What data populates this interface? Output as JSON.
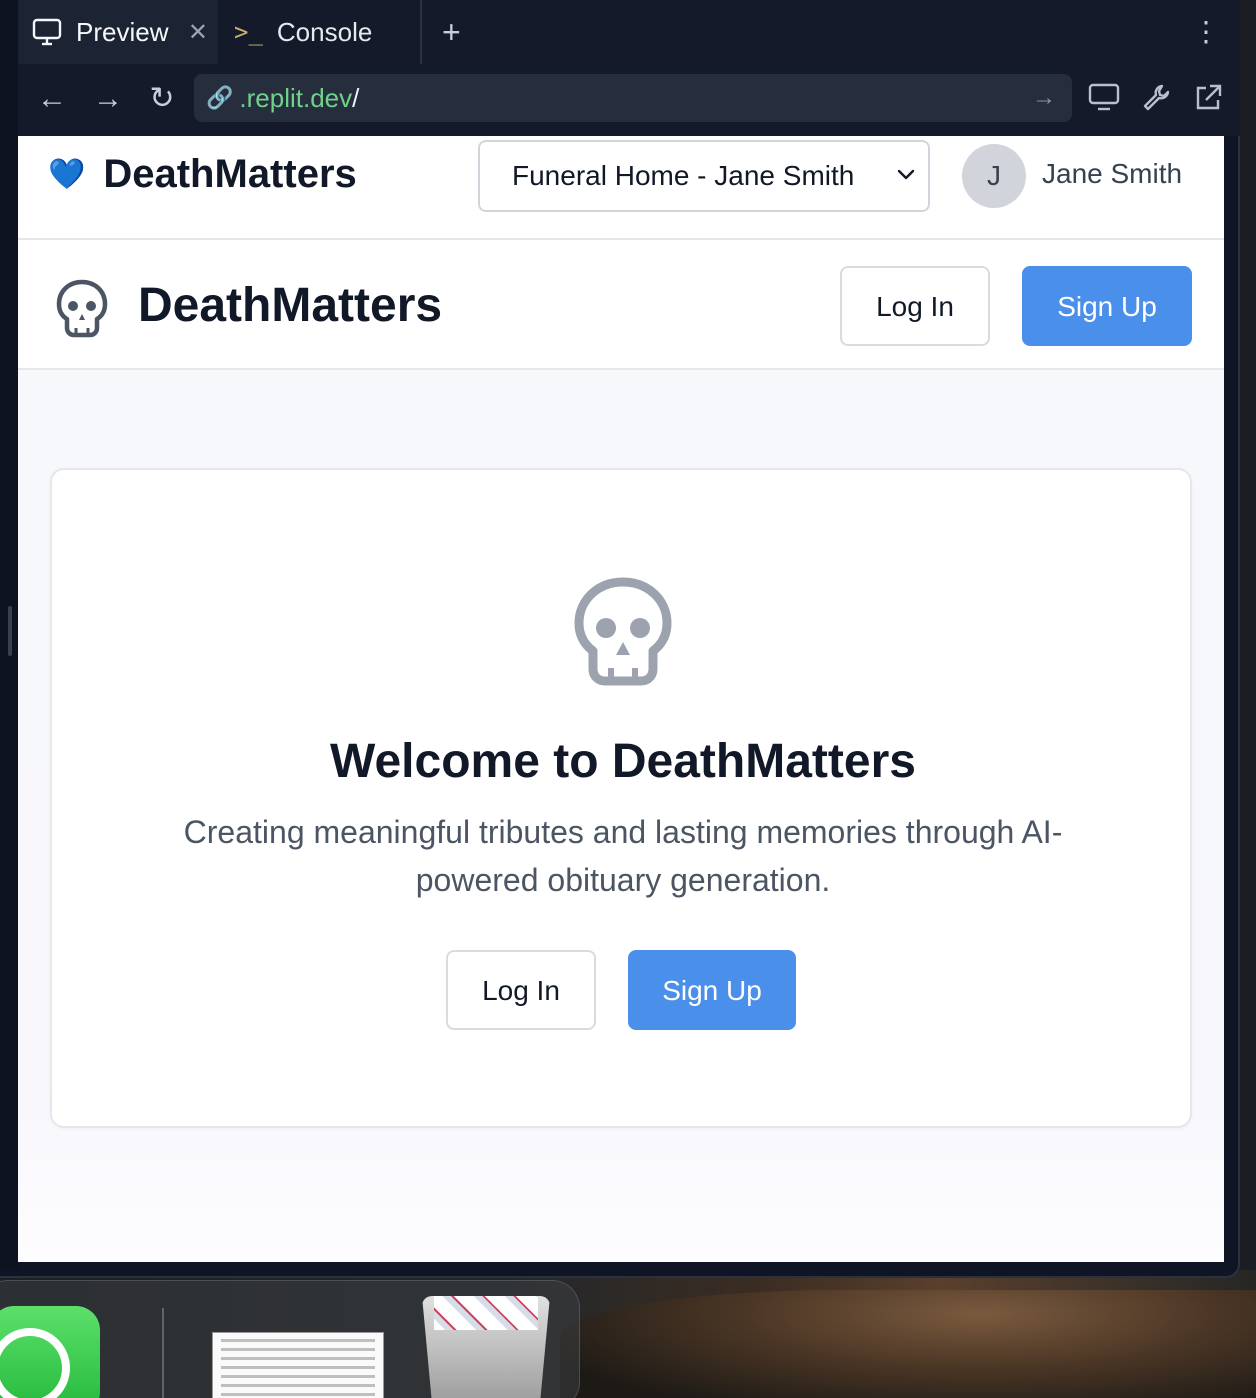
{
  "browser": {
    "tabs": [
      {
        "label": "Preview",
        "icon": "monitor-icon",
        "active": true
      },
      {
        "label": "Console",
        "icon": "terminal-icon",
        "active": false
      }
    ],
    "url": {
      "host": ".replit.dev",
      "path": "/"
    }
  },
  "app": {
    "topbar": {
      "brand": "DeathMatters",
      "brand_icon": "blue-heart-icon",
      "role_select": {
        "selected": "Funeral Home - Jane Smith"
      },
      "user": {
        "initial": "J",
        "name": "Jane Smith"
      }
    },
    "header": {
      "brand": "DeathMatters",
      "login_label": "Log In",
      "signup_label": "Sign Up"
    },
    "hero": {
      "title": "Welcome to DeathMatters",
      "tagline": "Creating meaningful tributes and lasting memories through AI-powered obituary generation.",
      "login_label": "Log In",
      "signup_label": "Sign Up"
    },
    "colors": {
      "primary": "#4a90ea",
      "text": "#111827",
      "muted": "#4b5563"
    }
  }
}
